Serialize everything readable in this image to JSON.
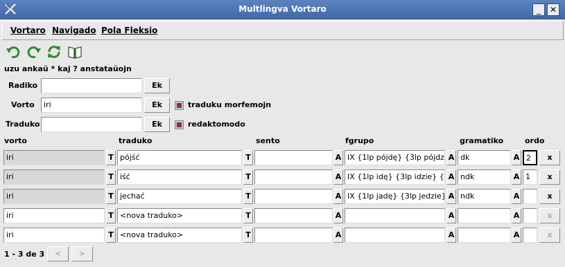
{
  "window": {
    "title": "Multlingva Vortaro",
    "minimize_label": "_",
    "close_label": "✕"
  },
  "menus": [
    {
      "label": "Vortaro"
    },
    {
      "label": "Navigado"
    },
    {
      "label": "Pola Fleksio"
    }
  ],
  "toolbar": [
    "undo-icon",
    "redo-icon",
    "refresh-icon",
    "book-icon"
  ],
  "hint": "uzu ankaŭ * kaj ? anstataŭojn",
  "search": {
    "radiko_label": "Radiko",
    "radiko_value": "",
    "vorto_label": "Vorto",
    "vorto_value": "iri",
    "traduko_label": "Traduko",
    "traduko_value": "",
    "ek_label": "Ek",
    "chk_morfemojn": "traduku morfemojn",
    "chk_redakto": "redaktomodo"
  },
  "columns": {
    "vorto": "vorto",
    "traduko": "traduko",
    "sento": "sento",
    "fgrupo": "fgrupo",
    "gramatiko": "gramatiko",
    "ordo": "ordo"
  },
  "buttons": {
    "t": "T",
    "a": "A",
    "x": "x"
  },
  "rows": [
    {
      "vorto": "iri",
      "traduko": "pójść",
      "sento": "",
      "fgrupo": "IX {1lp pójdę} {3lp pójdzie",
      "gramatiko": "dk",
      "ordo": "2"
    },
    {
      "vorto": "iri",
      "traduko": "iść",
      "sento": "",
      "fgrupo": "IX {1lp idę} {3lp idzie} {3l",
      "gramatiko": "ndk",
      "ordo": "1"
    },
    {
      "vorto": "iri",
      "traduko": "jechać",
      "sento": "",
      "fgrupo": "IX {1lp jadę} {3lp jedzie} {",
      "gramatiko": "ndk",
      "ordo": ""
    },
    {
      "vorto": "iri",
      "traduko": "<nova traduko>",
      "sento": "",
      "fgrupo": "",
      "gramatiko": "",
      "ordo": ""
    },
    {
      "vorto": "iri",
      "traduko": "<nova traduko>",
      "sento": "",
      "fgrupo": "",
      "gramatiko": "",
      "ordo": ""
    }
  ],
  "pager": {
    "text": "1 - 3 de 3",
    "prev": "<",
    "next": ">"
  },
  "colors": {
    "titlebar": "#4a74b3",
    "checkbox": "#8e2a4a"
  }
}
